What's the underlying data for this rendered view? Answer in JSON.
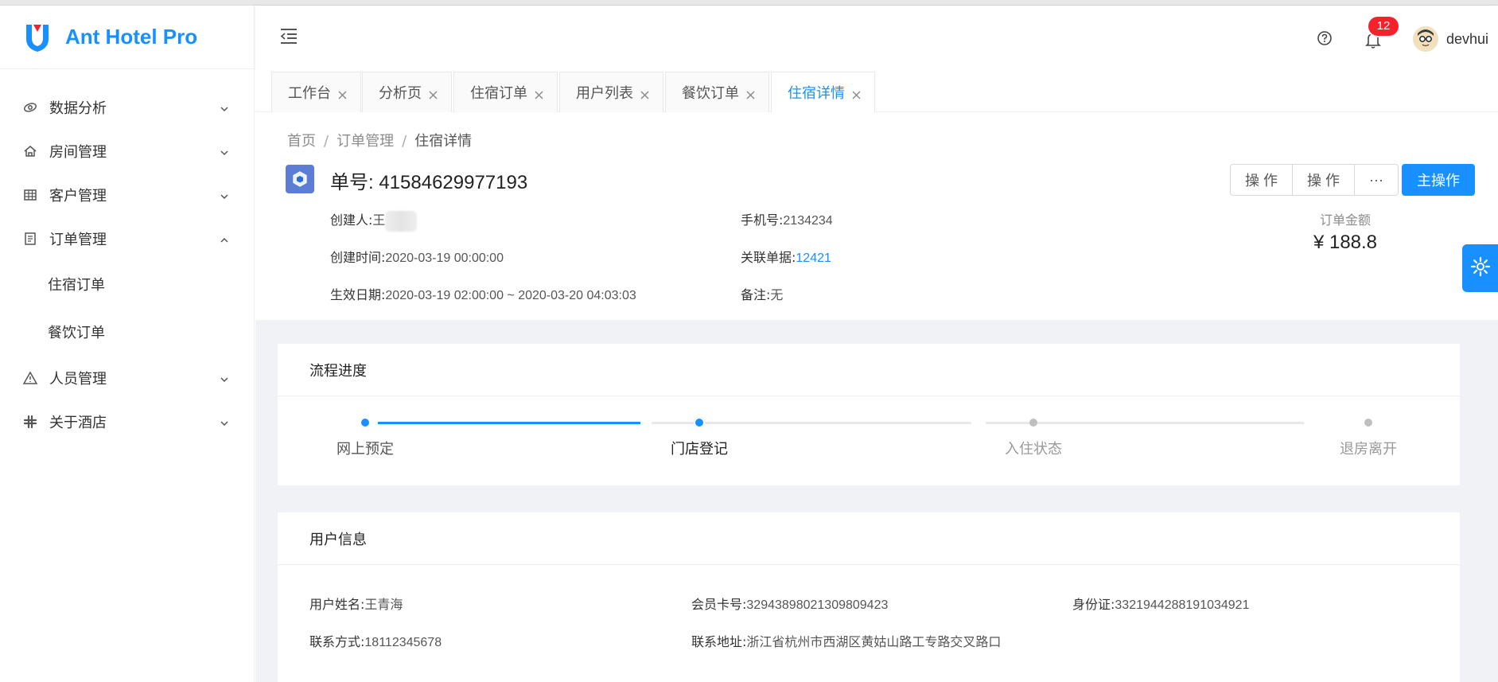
{
  "app": {
    "title": "Ant Hotel Pro"
  },
  "sidebar": {
    "items": [
      {
        "label": "数据分析",
        "icon": "data-analysis-icon",
        "expanded": false
      },
      {
        "label": "房间管理",
        "icon": "home-icon",
        "expanded": false
      },
      {
        "label": "客户管理",
        "icon": "table-icon",
        "expanded": false
      },
      {
        "label": "订单管理",
        "icon": "order-icon",
        "expanded": true,
        "children": [
          {
            "label": "住宿订单"
          },
          {
            "label": "餐饮订单"
          }
        ]
      },
      {
        "label": "人员管理",
        "icon": "warning-icon",
        "expanded": false
      },
      {
        "label": "关于酒店",
        "icon": "slack-icon",
        "expanded": false
      }
    ]
  },
  "header": {
    "notification_count": "12",
    "username": "devhui"
  },
  "tabs": [
    {
      "label": "工作台",
      "active": false
    },
    {
      "label": "分析页",
      "active": false
    },
    {
      "label": "住宿订单",
      "active": false
    },
    {
      "label": "用户列表",
      "active": false
    },
    {
      "label": "餐饮订单",
      "active": false
    },
    {
      "label": "住宿详情",
      "active": true
    }
  ],
  "breadcrumb": [
    "首页",
    "订单管理",
    "住宿详情"
  ],
  "order": {
    "number": "单号: 41584629977193",
    "creator_label": "创建人:",
    "creator_value": "王",
    "phone_label": "手机号:",
    "phone_value": "2134234",
    "created_label": "创建时间:",
    "created_value": "2020-03-19 00:00:00",
    "related_label": "关联单据:",
    "related_value": "12421",
    "effective_label": "生效日期:",
    "effective_value": "2020-03-19 02:00:00 ~ 2020-03-20 04:03:03",
    "remark_label": "备注:",
    "remark_value": "无",
    "amount_label": "订单金额",
    "amount_value": "¥ 188.8"
  },
  "actions": {
    "action1": "操 作",
    "action2": "操 作",
    "more": "···",
    "primary": "主操作"
  },
  "progress": {
    "title": "流程进度",
    "steps": [
      "网上预定",
      "门店登记",
      "入住状态",
      "退房离开"
    ],
    "current_step_index": 1
  },
  "user_info": {
    "title": "用户信息",
    "name_label": "用户姓名:",
    "name_value": "王青海",
    "card_label": "会员卡号:",
    "card_value": "32943898021309809423",
    "id_label": "身份证:",
    "id_value": "3321944288191034921",
    "contact_label": "联系方式:",
    "contact_value": "18112345678",
    "address_label": "联系地址:",
    "address_value": "浙江省杭州市西湖区黄姑山路工专路交叉路口"
  },
  "colors": {
    "primary": "#1890ff",
    "badge": "#f5222d",
    "bg": "#f0f2f5"
  }
}
